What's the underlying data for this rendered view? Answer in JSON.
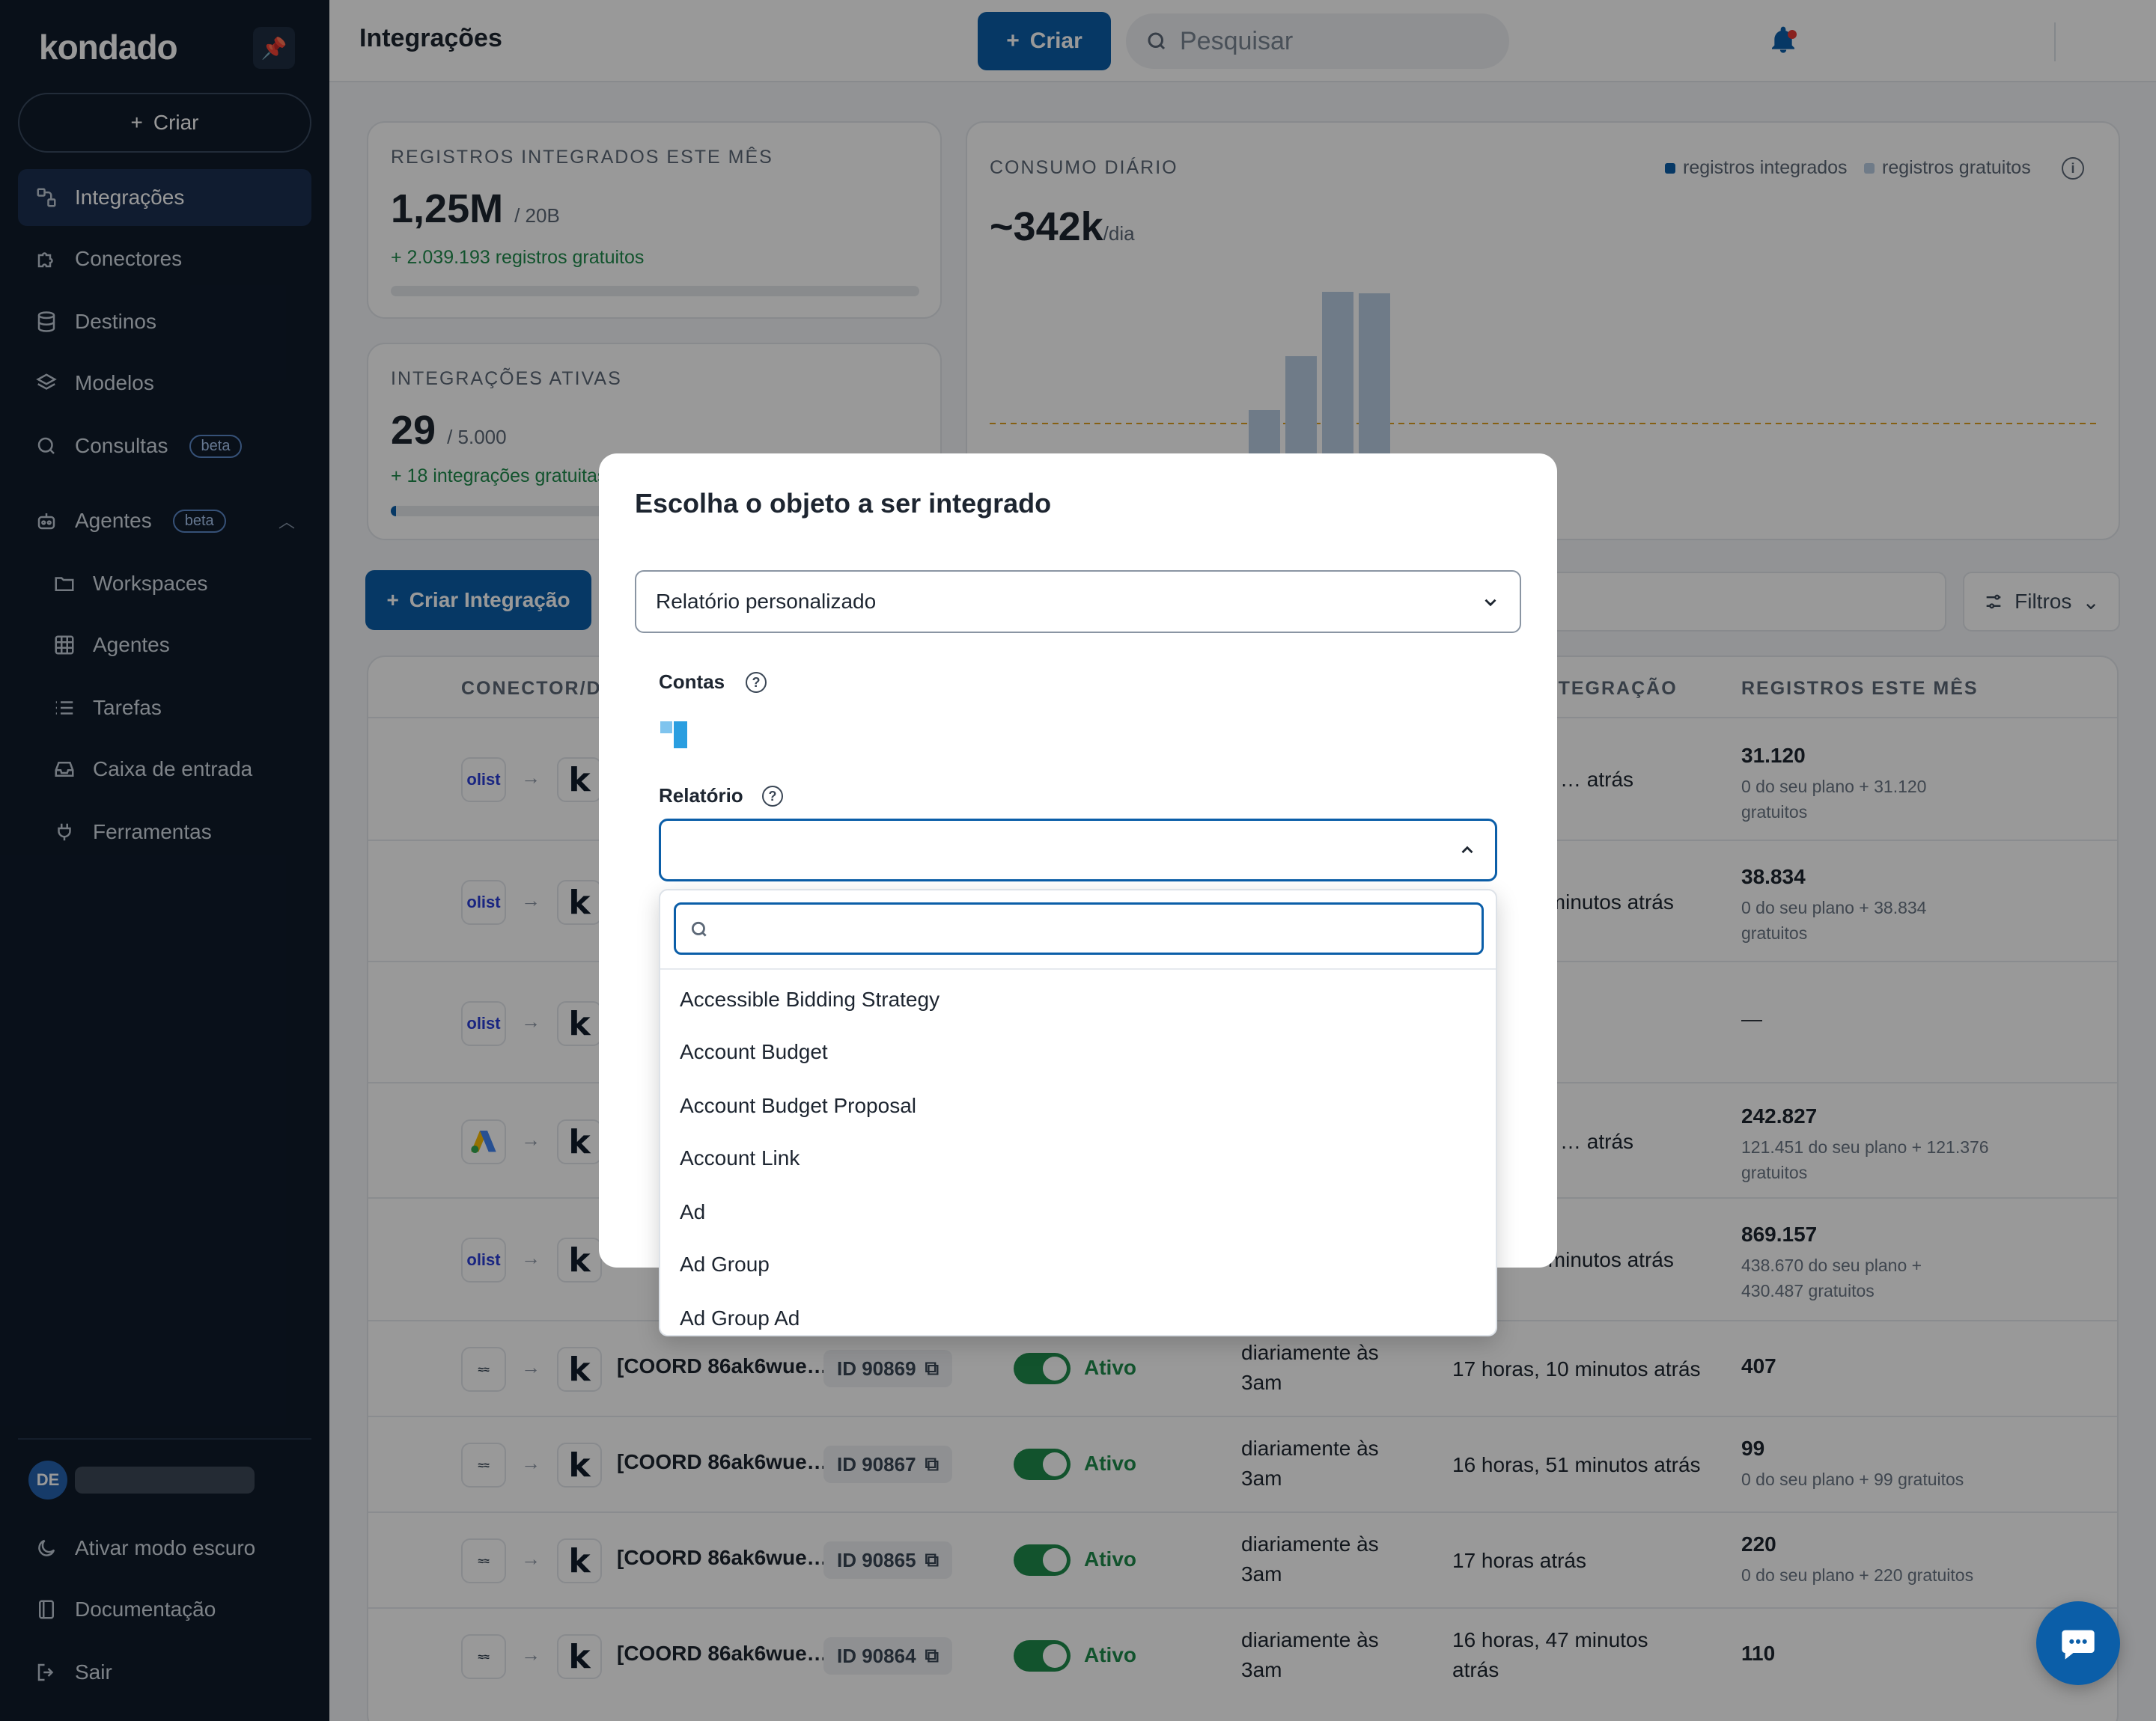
{
  "sidebar": {
    "logo": "kondado",
    "create_label": "Criar",
    "nav": [
      {
        "label": "Integrações",
        "icon": "integrations-icon"
      },
      {
        "label": "Conectores",
        "icon": "puzzle-icon"
      },
      {
        "label": "Destinos",
        "icon": "database-icon"
      },
      {
        "label": "Modelos",
        "icon": "layers-icon"
      },
      {
        "label": "Consultas",
        "icon": "search-icon",
        "badge": "beta"
      },
      {
        "label": "Agentes",
        "icon": "robot-icon",
        "badge": "beta"
      },
      {
        "label": "Workspaces",
        "icon": "folder-icon"
      },
      {
        "label": "Agentes",
        "icon": "grid-icon"
      },
      {
        "label": "Tarefas",
        "icon": "list-icon"
      },
      {
        "label": "Caixa de entrada",
        "icon": "inbox-icon"
      },
      {
        "label": "Ferramentas",
        "icon": "plug-icon"
      }
    ],
    "user_initials": "DE",
    "dark_mode": "Ativar modo escuro",
    "docs": "Documentação",
    "logout": "Sair"
  },
  "header": {
    "title": "Integrações",
    "create_label": "Criar",
    "search_placeholder": "Pesquisar"
  },
  "cards": {
    "records": {
      "label": "REGISTROS INTEGRADOS ESTE MÊS",
      "value": "1,25M",
      "limit": "/ 20B",
      "free": "+ 2.039.193 registros gratuitos",
      "progress": 0.0
    },
    "active": {
      "label": "INTEGRAÇÕES ATIVAS",
      "value": "29",
      "limit": "/ 5.000",
      "free": "+ 18 integrações gratuitas",
      "progress": 0.006
    },
    "consumption": {
      "label": "CONSUMO DIÁRIO",
      "value": "~342k",
      "unit": "/dia",
      "legend_integrated": "registros integrados",
      "legend_free": "registros gratuitos",
      "integrated_color": "#0b5ea8",
      "free_color": "#b9cde3"
    }
  },
  "toolbar": {
    "create_integration": "Criar Integração",
    "filters": "Filtros"
  },
  "table": {
    "headers": {
      "connector": "CONECTOR/DESTINO",
      "last_integration": "ÚLTIMA INTEGRAÇÃO",
      "records": "REGISTROS ESTE MÊS"
    },
    "top_rows": [
      {
        "source": "olist",
        "last": "… atrás",
        "records": "31.120",
        "sub1": "0 do seu plano + 31.120",
        "sub2": "gratuitos"
      },
      {
        "source": "olist",
        "last": "… minutos atrás",
        "records": "38.834",
        "sub1": "0 do seu plano + 38.834",
        "sub2": "gratuitos"
      },
      {
        "source": "olist",
        "last": "",
        "records": "—",
        "sub1": "",
        "sub2": ""
      },
      {
        "source": "google-ads",
        "last": "… atrás",
        "records": "242.827",
        "sub1": "121.451 do seu plano + 121.376",
        "sub2": "gratuitos"
      },
      {
        "source": "olist",
        "last": "… minutos atrás",
        "records": "869.157",
        "sub1": "438.670 do seu plano +",
        "sub2": "430.487 gratuitos"
      }
    ],
    "rows": [
      {
        "name": "[COORD 86ak6wue…",
        "id": "ID 90869",
        "status": "Ativo",
        "schedule1": "diariamente às",
        "schedule2": "3am",
        "last1": "17 horas, 10 minutos atrás",
        "last2": "",
        "records": "407",
        "sub": ""
      },
      {
        "name": "[COORD 86ak6wue…",
        "id": "ID 90867",
        "status": "Ativo",
        "schedule1": "diariamente às",
        "schedule2": "3am",
        "last1": "16 horas, 51 minutos atrás",
        "last2": "",
        "records": "99",
        "sub": "0 do seu plano + 99 gratuitos"
      },
      {
        "name": "[COORD 86ak6wue…",
        "id": "ID 90865",
        "status": "Ativo",
        "schedule1": "diariamente às",
        "schedule2": "3am",
        "last1": "17 horas atrás",
        "last2": "",
        "records": "220",
        "sub": "0 do seu plano + 220 gratuitos"
      },
      {
        "name": "[COORD 86ak6wue…",
        "id": "ID 90864",
        "status": "Ativo",
        "schedule1": "diariamente às",
        "schedule2": "3am",
        "last1": "16 horas, 47 minutos",
        "last2": "atrás",
        "records": "110",
        "sub": ""
      }
    ]
  },
  "modal": {
    "title": "Escolha o objeto a ser integrado",
    "object_type": "Relatório personalizado",
    "accounts_label": "Contas",
    "report_label": "Relatório",
    "report_value": "",
    "dropdown_search_placeholder": "",
    "options": [
      "Accessible Bidding Strategy",
      "Account Budget",
      "Account Budget Proposal",
      "Account Link",
      "Ad",
      "Ad Group",
      "Ad Group Ad"
    ]
  },
  "chart_data": {
    "type": "bar",
    "title": "",
    "series": [
      {
        "name": "registros integrados",
        "values": [
          0,
          0,
          0,
          0,
          0.14,
          0.14,
          0.14,
          0.09
        ]
      },
      {
        "name": "registros gratuitos",
        "values": [
          0.2,
          0.18,
          0.18,
          0.1,
          0.24,
          0.42,
          0.84,
          0.68
        ]
      }
    ],
    "reference_line": "~342k/dia"
  }
}
